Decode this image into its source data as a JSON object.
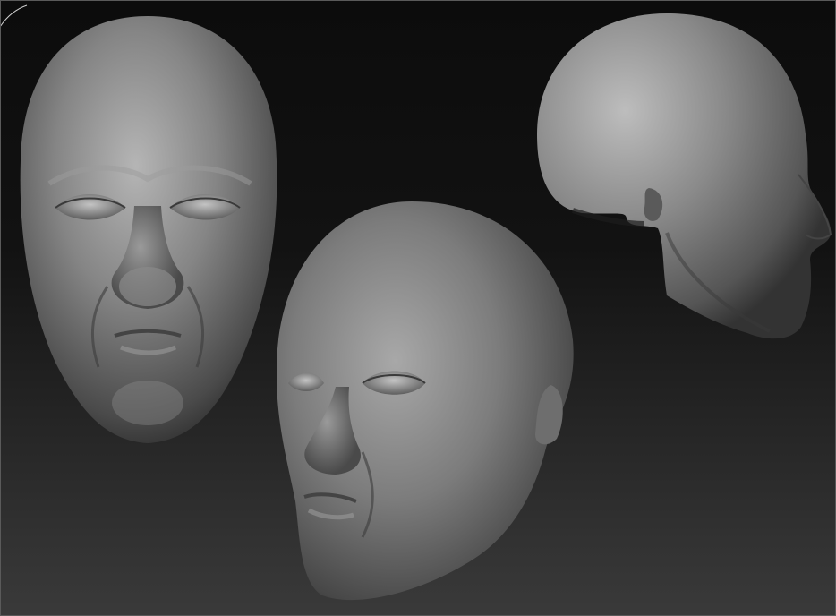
{
  "viewport": {
    "background_top": "#0c0c0c",
    "background_bottom": "#3a3a3a",
    "material_color": "#7a7a7a"
  },
  "models": [
    {
      "name": "front-view-head-mask",
      "view": "front"
    },
    {
      "name": "three-quarter-view-head",
      "view": "three-quarter"
    },
    {
      "name": "profile-view-head",
      "view": "side"
    }
  ]
}
